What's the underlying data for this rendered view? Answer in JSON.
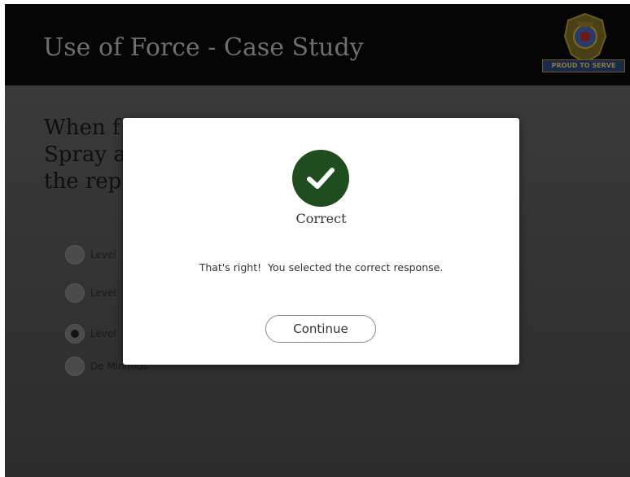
{
  "header": {
    "title": "Use of Force - Case Study",
    "badge_text": "PROUD TO SERVE",
    "badge_icon": "police-badge-logo"
  },
  "question": {
    "text": "When faced with ... Spray a... the rep..."
  },
  "options": [
    {
      "label": "Level ...",
      "selected": false
    },
    {
      "label": "Level ...",
      "selected": false
    },
    {
      "label": "Level ...",
      "selected": true
    },
    {
      "label": "De Minimus",
      "selected": false
    }
  ],
  "feedback_dialog": {
    "icon": "check-circle-icon",
    "icon_color": "#1f4d1f",
    "heading": "Correct",
    "message": "That's right!  You selected the correct response.",
    "continue_label": "Continue"
  },
  "colors": {
    "title_bar": "#050505",
    "content_bg": "#343434",
    "dialog_bg": "#ffffff"
  }
}
